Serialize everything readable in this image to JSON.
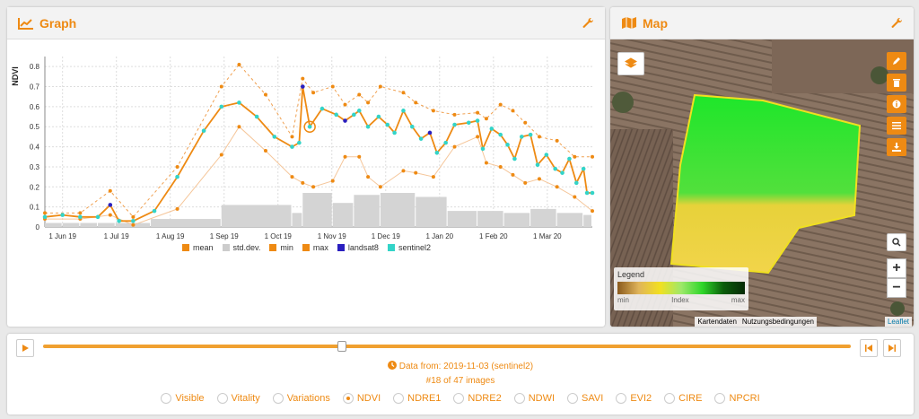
{
  "graph": {
    "title": "Graph",
    "legend": [
      {
        "label": "mean",
        "color": "#ee8a13"
      },
      {
        "label": "std.dev.",
        "color": "#cccccc"
      },
      {
        "label": "min",
        "color": "#ee8a13"
      },
      {
        "label": "max",
        "color": "#ee8a13"
      },
      {
        "label": "landsat8",
        "color": "#2a1fbf"
      },
      {
        "label": "sentinel2",
        "color": "#33d4c8"
      }
    ]
  },
  "chart_data": {
    "type": "line",
    "ylabel": "NDVI",
    "ylim": [
      0,
      0.85
    ],
    "yticks": [
      "0",
      "0.1",
      "0.2",
      "0.3",
      "0.4",
      "0.5",
      "0.6",
      "0.7",
      "0.8"
    ],
    "xticks": [
      "1 Jun 19",
      "1 Jul 19",
      "1 Aug 19",
      "1 Sep 19",
      "1 Oct 19",
      "1 Nov 19",
      "1 Dec 19",
      "1 Jan 20",
      "1 Feb 20",
      "1 Mar 20"
    ],
    "series": [
      {
        "name": "mean",
        "points": [
          [
            0,
            0.05
          ],
          [
            10,
            0.06
          ],
          [
            20,
            0.05
          ],
          [
            30,
            0.05
          ],
          [
            37,
            0.11
          ],
          [
            42,
            0.03
          ],
          [
            50,
            0.03
          ],
          [
            62,
            0.08
          ],
          [
            75,
            0.25
          ],
          [
            90,
            0.48
          ],
          [
            100,
            0.6
          ],
          [
            110,
            0.62
          ],
          [
            120,
            0.55
          ],
          [
            130,
            0.45
          ],
          [
            140,
            0.4
          ],
          [
            144,
            0.42
          ],
          [
            146,
            0.7
          ],
          [
            150,
            0.5
          ],
          [
            157,
            0.59
          ],
          [
            165,
            0.56
          ],
          [
            170,
            0.53
          ],
          [
            175,
            0.56
          ],
          [
            178,
            0.58
          ],
          [
            183,
            0.5
          ],
          [
            189,
            0.55
          ],
          [
            194,
            0.51
          ],
          [
            198,
            0.47
          ],
          [
            203,
            0.58
          ],
          [
            208,
            0.5
          ],
          [
            213,
            0.44
          ],
          [
            218,
            0.47
          ],
          [
            222,
            0.37
          ],
          [
            227,
            0.42
          ],
          [
            232,
            0.51
          ],
          [
            240,
            0.52
          ],
          [
            245,
            0.53
          ],
          [
            248,
            0.39
          ],
          [
            253,
            0.49
          ],
          [
            258,
            0.46
          ],
          [
            262,
            0.41
          ],
          [
            266,
            0.34
          ],
          [
            270,
            0.45
          ],
          [
            275,
            0.46
          ],
          [
            279,
            0.31
          ],
          [
            284,
            0.36
          ],
          [
            289,
            0.29
          ],
          [
            293,
            0.27
          ],
          [
            297,
            0.34
          ],
          [
            301,
            0.22
          ],
          [
            305,
            0.29
          ],
          [
            307,
            0.17
          ],
          [
            310,
            0.17
          ]
        ]
      },
      {
        "name": "max",
        "points": [
          [
            0,
            0.07
          ],
          [
            20,
            0.07
          ],
          [
            37,
            0.18
          ],
          [
            50,
            0.05
          ],
          [
            75,
            0.3
          ],
          [
            100,
            0.7
          ],
          [
            110,
            0.81
          ],
          [
            125,
            0.66
          ],
          [
            140,
            0.45
          ],
          [
            146,
            0.74
          ],
          [
            152,
            0.67
          ],
          [
            163,
            0.7
          ],
          [
            170,
            0.61
          ],
          [
            178,
            0.66
          ],
          [
            183,
            0.62
          ],
          [
            190,
            0.7
          ],
          [
            203,
            0.67
          ],
          [
            210,
            0.62
          ],
          [
            220,
            0.58
          ],
          [
            232,
            0.56
          ],
          [
            245,
            0.57
          ],
          [
            250,
            0.54
          ],
          [
            258,
            0.61
          ],
          [
            265,
            0.58
          ],
          [
            272,
            0.52
          ],
          [
            280,
            0.45
          ],
          [
            290,
            0.43
          ],
          [
            300,
            0.35
          ],
          [
            310,
            0.35
          ]
        ]
      },
      {
        "name": "min",
        "points": [
          [
            0,
            0.04
          ],
          [
            20,
            0.04
          ],
          [
            37,
            0.06
          ],
          [
            50,
            0.01
          ],
          [
            75,
            0.09
          ],
          [
            100,
            0.36
          ],
          [
            110,
            0.5
          ],
          [
            125,
            0.38
          ],
          [
            140,
            0.25
          ],
          [
            146,
            0.22
          ],
          [
            152,
            0.2
          ],
          [
            163,
            0.23
          ],
          [
            170,
            0.35
          ],
          [
            178,
            0.35
          ],
          [
            183,
            0.25
          ],
          [
            190,
            0.2
          ],
          [
            203,
            0.28
          ],
          [
            210,
            0.27
          ],
          [
            220,
            0.25
          ],
          [
            232,
            0.4
          ],
          [
            245,
            0.45
          ],
          [
            250,
            0.32
          ],
          [
            258,
            0.3
          ],
          [
            265,
            0.26
          ],
          [
            272,
            0.22
          ],
          [
            280,
            0.24
          ],
          [
            290,
            0.2
          ],
          [
            300,
            0.15
          ],
          [
            310,
            0.08
          ]
        ]
      }
    ],
    "std_dev_bars": [
      [
        0,
        0.02
      ],
      [
        10,
        0.02
      ],
      [
        20,
        0.02
      ],
      [
        30,
        0.02
      ],
      [
        40,
        0.02
      ],
      [
        60,
        0.04
      ],
      [
        100,
        0.11
      ],
      [
        140,
        0.07
      ],
      [
        146,
        0.17
      ],
      [
        163,
        0.12
      ],
      [
        175,
        0.16
      ],
      [
        190,
        0.17
      ],
      [
        210,
        0.15
      ],
      [
        228,
        0.08
      ],
      [
        245,
        0.08
      ],
      [
        260,
        0.07
      ],
      [
        275,
        0.09
      ],
      [
        290,
        0.07
      ],
      [
        305,
        0.06
      ]
    ],
    "highlight_index": 17
  },
  "map": {
    "title": "Map",
    "legend_title": "Legend",
    "legend_min": "min",
    "legend_mid": "Index",
    "legend_max": "max",
    "attribution_1": "Kartendaten",
    "attribution_2": "Nutzungsbedingungen",
    "leaflet": "Leaflet",
    "zoom_in": "+",
    "zoom_out": "−"
  },
  "timeline": {
    "data_from": "Data from: 2019-11-03 (sentinel2)",
    "image_count": "#18 of 47 images",
    "position": 0.37,
    "indices": [
      "Visible",
      "Vitality",
      "Variations",
      "NDVI",
      "NDRE1",
      "NDRE2",
      "NDWI",
      "SAVI",
      "EVI2",
      "CIRE",
      "NPCRI"
    ],
    "selected": "NDVI"
  }
}
